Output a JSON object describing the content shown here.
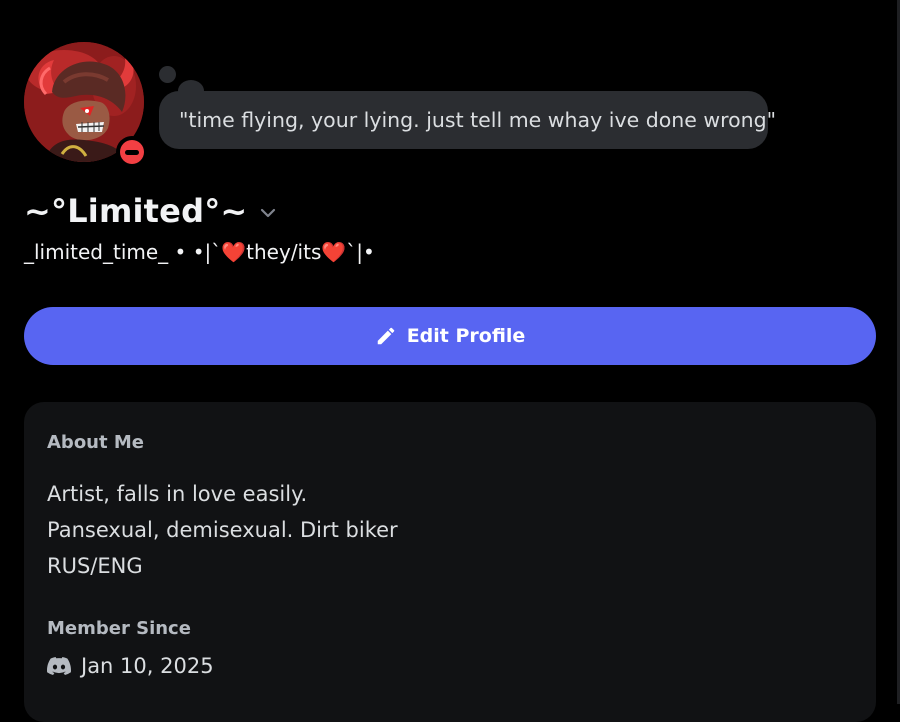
{
  "profile": {
    "status_text": "\"time flying, your lying. just tell me whay ive done wrong\"",
    "display_name": "~°Limited°~",
    "username": "_limited_time_",
    "separator": " • ",
    "pronoun_prefix": "•|`",
    "heart_left": "❤️",
    "pronouns": "they/its",
    "heart_right": "❤️",
    "pronoun_suffix": "`|•",
    "status": "do-not-disturb"
  },
  "actions": {
    "edit_profile_label": "Edit Profile",
    "edit_icon": "pencil-icon"
  },
  "about": {
    "title": "About Me",
    "lines": [
      "Artist, falls in love easily.",
      "Pansexual, demisexual. Dirt biker",
      "RUS/ENG"
    ]
  },
  "member_since": {
    "title": "Member Since",
    "icon": "discord-icon",
    "date": "Jan 10, 2025"
  },
  "colors": {
    "background": "#000000",
    "bubble": "#2b2d31",
    "accent": "#5865f2",
    "card": "#111214",
    "dnd_red": "#f23f43",
    "heart": "#dd2e44"
  }
}
